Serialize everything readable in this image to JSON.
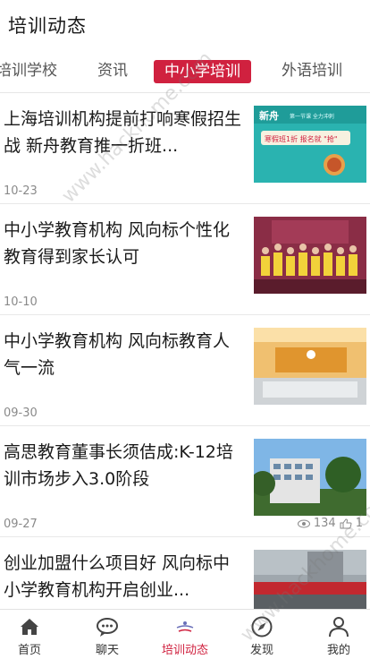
{
  "header": {
    "title": "培训动态"
  },
  "tabs": [
    {
      "label": "培训学校",
      "active": false
    },
    {
      "label": "资讯",
      "active": false
    },
    {
      "label": "中小学培训",
      "active": true
    },
    {
      "label": "外语培训",
      "active": false
    }
  ],
  "articles": [
    {
      "title": "上海培训机构提前打响寒假招生战 新舟教育推一折班...",
      "date": "10-23",
      "thumb": {
        "brand": "新舟",
        "promo_main": "寒假班1折 报名就 \"抢\"",
        "promo_sub": "第一节课 全力冲刺"
      }
    },
    {
      "title": "中小学教育机构 风向标个性化教育得到家长认可",
      "date": "10-10"
    },
    {
      "title": "中小学教育机构 风向标教育人气一流",
      "date": "09-30"
    },
    {
      "title": "高思教育董事长须佶成:K-12培训市场步入3.0阶段",
      "date": "09-27",
      "views": "134",
      "likes": "1"
    },
    {
      "title": "创业加盟什么项目好 风向标中小学教育机构开启创业...",
      "date": ""
    }
  ],
  "bottom_nav": [
    {
      "label": "首页",
      "icon": "home-icon",
      "active": false
    },
    {
      "label": "聊天",
      "icon": "chat-icon",
      "active": false
    },
    {
      "label": "培训动态",
      "icon": "training-news-icon",
      "active": true
    },
    {
      "label": "发现",
      "icon": "compass-icon",
      "active": false
    },
    {
      "label": "我的",
      "icon": "profile-icon",
      "active": false
    }
  ],
  "watermark": {
    "text": "www.hackhome.com"
  },
  "colors": {
    "accent": "#d0213f",
    "text": "#1a1a1a",
    "muted": "#8a8a8a"
  }
}
